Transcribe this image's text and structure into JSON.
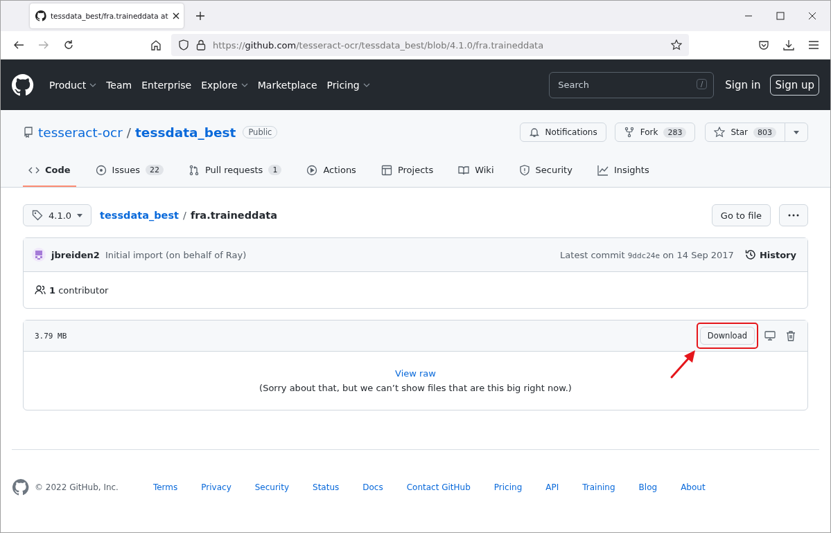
{
  "browser": {
    "tab_title": "tessdata_best/fra.traineddata at",
    "url_scheme": "https://",
    "url_host": "github.com",
    "url_path": "/tesseract-ocr/tessdata_best/blob/4.1.0/fra.traineddata"
  },
  "header": {
    "nav": [
      {
        "label": "Product",
        "has_menu": true
      },
      {
        "label": "Team",
        "has_menu": false
      },
      {
        "label": "Enterprise",
        "has_menu": false
      },
      {
        "label": "Explore",
        "has_menu": true
      },
      {
        "label": "Marketplace",
        "has_menu": false
      },
      {
        "label": "Pricing",
        "has_menu": true
      }
    ],
    "search": {
      "placeholder": "Search",
      "shortcut": "/"
    },
    "sign_in": "Sign in",
    "sign_up": "Sign up"
  },
  "repo": {
    "owner": "tesseract-ocr",
    "separator": "/",
    "name": "tessdata_best",
    "visibility": "Public",
    "notifications": "Notifications",
    "fork": {
      "label": "Fork",
      "count": "283"
    },
    "star": {
      "label": "Star",
      "count": "803"
    }
  },
  "tabs": [
    {
      "kind": "code",
      "label": "Code",
      "selected": true
    },
    {
      "kind": "issues",
      "label": "Issues",
      "count": "22",
      "selected": false
    },
    {
      "kind": "pulls",
      "label": "Pull requests",
      "count": "1",
      "selected": false
    },
    {
      "kind": "actions",
      "label": "Actions",
      "selected": false
    },
    {
      "kind": "projects",
      "label": "Projects",
      "selected": false
    },
    {
      "kind": "wiki",
      "label": "Wiki",
      "selected": false
    },
    {
      "kind": "security",
      "label": "Security",
      "selected": false
    },
    {
      "kind": "insights",
      "label": "Insights",
      "selected": false
    }
  ],
  "file": {
    "branch": "4.1.0",
    "repo_link": "tessdata_best",
    "separator": "/",
    "file_name": "fra.traineddata",
    "go_to_file": "Go to file",
    "commit": {
      "author": "jbreiden2",
      "message": "Initial import (on behalf of Ray)",
      "latest": "Latest commit",
      "sha": "9ddc24e",
      "date": "on 14 Sep 2017",
      "history": "History"
    },
    "contributors": {
      "count": "1",
      "label": "contributor"
    },
    "size": "3.79 MB",
    "download": "Download",
    "view_raw": "View raw",
    "too_big": "(Sorry about that, but we can’t show files that are this big right now.)"
  },
  "footer": {
    "copyright": "© 2022 GitHub, Inc.",
    "links": [
      "Terms",
      "Privacy",
      "Security",
      "Status",
      "Docs",
      "Contact GitHub",
      "Pricing",
      "API",
      "Training",
      "Blog",
      "About"
    ]
  }
}
